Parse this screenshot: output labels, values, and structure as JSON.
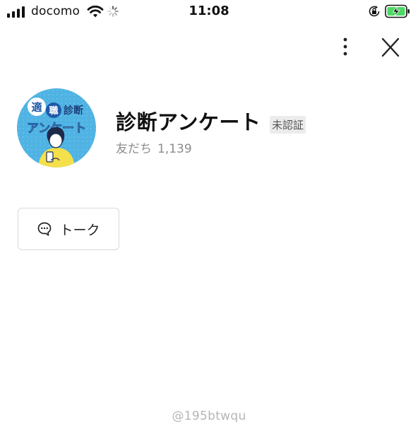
{
  "status_bar": {
    "carrier": "docomo",
    "time": "11:08",
    "icons": [
      "signal-icon",
      "wifi-icon",
      "loading-spinner-icon",
      "rotation-lock-icon",
      "battery-charging-icon"
    ]
  },
  "header": {
    "more_icon": "more-vertical-icon",
    "close_icon": "close-icon"
  },
  "profile": {
    "avatar_text": {
      "line1_a": "適",
      "line1_b": "職",
      "line1_c": "診断",
      "line2": "アンケート"
    },
    "name": "診断アンケート",
    "badge": "未認証",
    "friends_label": "友だち",
    "friends_count": "1,139"
  },
  "actions": {
    "talk_label": "トーク",
    "talk_icon": "chat-bubble-icon"
  },
  "watermark": "@195btwqu",
  "colors": {
    "avatar_bg": "#4fb3e3",
    "avatar_text_yellow": "#f7e93a",
    "badge_bg": "#ececec",
    "muted_text": "#8c8c8c",
    "battery_green": "#4cd964"
  }
}
